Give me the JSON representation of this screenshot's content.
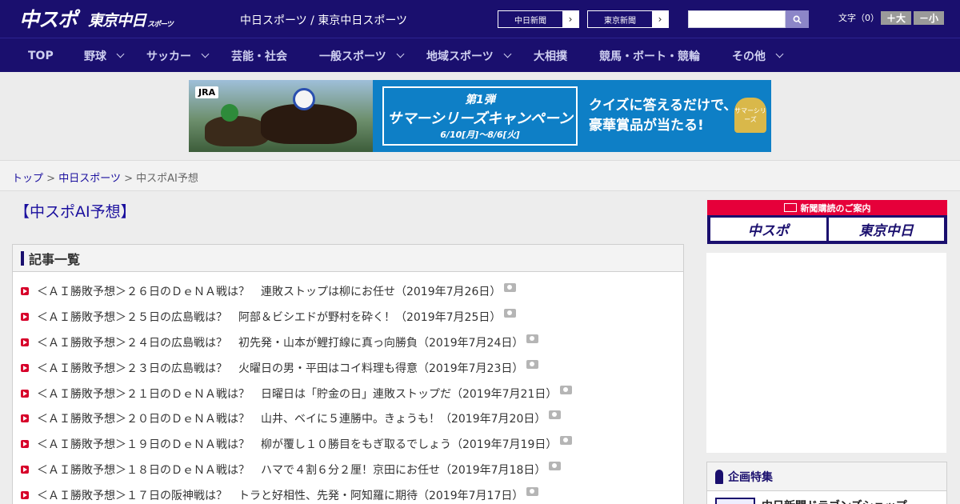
{
  "header": {
    "logo_chunichi": "中スポ",
    "logo_tokyo": "東京中日",
    "logo_tokyo_sub": "スポーツ",
    "site_title": "中日スポーツ / 東京中日スポーツ",
    "paper_buttons": [
      "中日新聞",
      "東京新聞"
    ],
    "search_placeholder": "",
    "font_size_label": "文字（0）",
    "font_larger": "＋大",
    "font_smaller": "－小"
  },
  "nav": {
    "items": [
      "TOP",
      "野球",
      "サッカー",
      "芸能・社会",
      "一般スポーツ",
      "地域スポーツ",
      "大相撲",
      "競馬・ボート・競輪",
      "その他"
    ]
  },
  "banner": {
    "brand": "JRA",
    "campaign_line1": "第1弾",
    "campaign_line2": "サマーシリーズキャンペーン",
    "campaign_line3": "6/10[月]～8/6[火]",
    "promo_line1": "クイズに答えるだけで、",
    "promo_line2": "豪華賞品が当たる!",
    "badge": "サマーシリーズ"
  },
  "breadcrumb": {
    "home": "トップ",
    "section": "中日スポーツ",
    "current": "中スポAI予想",
    "sep": ">"
  },
  "main": {
    "page_title": "【中スポAI予想】",
    "list_heading": "記事一覧",
    "articles": [
      "＜ＡＩ勝敗予想＞２６日のＤｅＮＡ戦は？　連敗ストップは柳にお任せ（2019年7月26日）",
      "＜ＡＩ勝敗予想＞２５日の広島戦は？　阿部＆ビシエドが野村を砕く！（2019年7月25日）",
      "＜ＡＩ勝敗予想＞２４日の広島戦は？　初先発・山本が鯉打線に真っ向勝負（2019年7月24日）",
      "＜ＡＩ勝敗予想＞２３日の広島戦は？　火曜日の男・平田はコイ料理も得意（2019年7月23日）",
      "＜ＡＩ勝敗予想＞２１日のＤｅＮＡ戦は？　日曜日は「貯金の日」連敗ストップだ（2019年7月21日）",
      "＜ＡＩ勝敗予想＞２０日のＤｅＮＡ戦は？　山井、ベイに５連勝中。きょうも！（2019年7月20日）",
      "＜ＡＩ勝敗予想＞１９日のＤｅＮＡ戦は？　柳が覆し１０勝目をもぎ取るでしょう（2019年7月19日）",
      "＜ＡＩ勝敗予想＞１８日のＤｅＮＡ戦は？　ハマで４割６分２厘！京田にお任せ（2019年7月18日）",
      "＜ＡＩ勝敗予想＞１７日の阪神戦は？　トラと好相性、先発・阿知羅に期待（2019年7月17日）"
    ]
  },
  "sidebar": {
    "subscribe_label": "新聞購読のご案内",
    "subscribe_logos": [
      "中スポ",
      "東京中日"
    ],
    "feature_heading": "企画特集",
    "feature_item": "中日新聞ドラゴンズショップ"
  },
  "colors": {
    "navy": "#1a0f6e",
    "accent_red": "#d7002a",
    "link": "#1a0f9e"
  }
}
